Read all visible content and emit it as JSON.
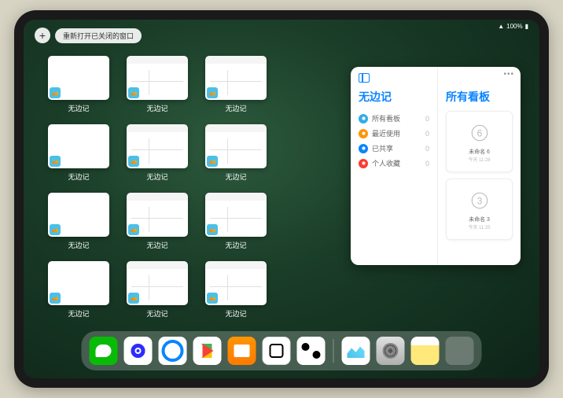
{
  "status": {
    "battery": "100%"
  },
  "topbar": {
    "plus": "+",
    "reopen": "重新打开已关闭的窗口"
  },
  "thumbs": [
    {
      "label": "无边记",
      "style": "blank"
    },
    {
      "label": "无边记",
      "style": "cal"
    },
    {
      "label": "无边记",
      "style": "cal"
    },
    {
      "label": "无边记",
      "style": "blank"
    },
    {
      "label": "无边记",
      "style": "cal"
    },
    {
      "label": "无边记",
      "style": "cal"
    },
    {
      "label": "无边记",
      "style": "blank"
    },
    {
      "label": "无边记",
      "style": "cal"
    },
    {
      "label": "无边记",
      "style": "cal"
    },
    {
      "label": "无边记",
      "style": "blank"
    },
    {
      "label": "无边记",
      "style": "cal"
    },
    {
      "label": "无边记",
      "style": "cal"
    }
  ],
  "panel": {
    "title": "无边记",
    "right_title": "所有看板",
    "menu": [
      {
        "label": "所有看板",
        "count": "0",
        "color": "#32ade6"
      },
      {
        "label": "最近使用",
        "count": "0",
        "color": "#ff9500"
      },
      {
        "label": "已共享",
        "count": "0",
        "color": "#0a84ff"
      },
      {
        "label": "个人收藏",
        "count": "0",
        "color": "#ff3b30"
      }
    ],
    "boards": [
      {
        "label": "未命名 6",
        "sub": "今天 11:28",
        "num": "6"
      },
      {
        "label": "未命名 3",
        "sub": "今天 11:25",
        "num": "3"
      }
    ]
  },
  "dock": [
    {
      "name": "wechat"
    },
    {
      "name": "browser1"
    },
    {
      "name": "qq"
    },
    {
      "name": "play"
    },
    {
      "name": "books"
    },
    {
      "name": "dice"
    },
    {
      "name": "connect"
    },
    {
      "sep": true
    },
    {
      "name": "freeform"
    },
    {
      "name": "settings"
    },
    {
      "name": "notes"
    },
    {
      "name": "multi"
    }
  ]
}
